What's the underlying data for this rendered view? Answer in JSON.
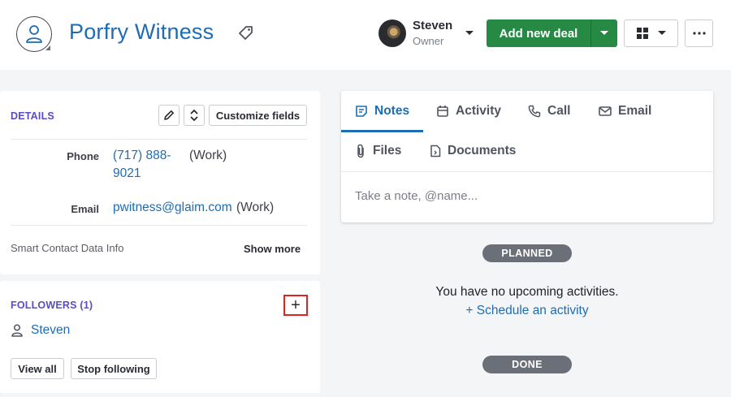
{
  "header": {
    "title": "Porfry Witness",
    "owner_name": "Steven",
    "owner_role": "Owner",
    "add_deal_label": "Add new deal"
  },
  "details": {
    "section_title": "DETAILS",
    "customize_label": "Customize fields",
    "phone_label": "Phone",
    "phone_line1": "(717) 888-",
    "phone_line2": "9021",
    "phone_type": "(Work)",
    "email_label": "Email",
    "email_value": "pwitness@glaim.com",
    "email_type": "(Work)",
    "smart_data_label": "Smart Contact Data Info",
    "show_more_label": "Show more"
  },
  "followers": {
    "section_title": "FOLLOWERS (1)",
    "add_symbol": "+",
    "follower_name": "Steven",
    "view_all_label": "View all",
    "stop_following_label": "Stop following"
  },
  "tabs": [
    {
      "label": "Notes",
      "icon": "note-icon",
      "active": true
    },
    {
      "label": "Activity",
      "icon": "calendar-icon",
      "active": false
    },
    {
      "label": "Call",
      "icon": "phone-icon",
      "active": false
    },
    {
      "label": "Email",
      "icon": "envelope-icon",
      "active": false
    },
    {
      "label": "Files",
      "icon": "paperclip-icon",
      "active": false
    },
    {
      "label": "Documents",
      "icon": "document-icon",
      "active": false
    }
  ],
  "note_input": {
    "placeholder": "Take a note, @name..."
  },
  "activities": {
    "planned_label": "PLANNED",
    "empty_text": "You have no upcoming activities.",
    "schedule_link": "+ Schedule an activity",
    "done_label": "DONE"
  },
  "colors": {
    "accent": "#1d6cb5",
    "primary_button": "#268a45",
    "section_title": "#5a4dc3",
    "highlight_box": "#e0231f"
  }
}
